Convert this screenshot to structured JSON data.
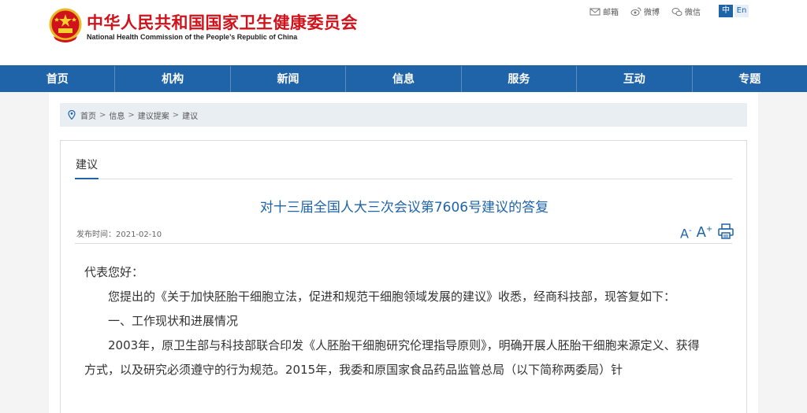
{
  "header": {
    "title_cn": "中华人民共和国国家卫生健康委员会",
    "title_en": "National Health Commission of the People’s Republic of China",
    "links": [
      {
        "label": "邮箱",
        "icon": "mail-icon"
      },
      {
        "label": "微博",
        "icon": "weibo-icon"
      },
      {
        "label": "微信",
        "icon": "wechat-icon"
      }
    ],
    "lang": {
      "zh": "中",
      "en": "En"
    }
  },
  "nav": [
    "首页",
    "机构",
    "新闻",
    "信息",
    "服务",
    "互动",
    "专题"
  ],
  "breadcrumb": [
    "首页",
    "信息",
    "建议提案",
    "建议"
  ],
  "section_label": "建议",
  "article": {
    "title": "对十三届全国人大三次会议第7606号建议的答复",
    "pubdate": "发布时间：2021-02-10",
    "paragraphs": [
      "代表您好：",
      "您提出的《关于加快胚胎干细胞立法，促进和规范干细胞领域发展的建议》收悉，经商科技部，现答复如下：",
      "一、工作现状和进展情况",
      "2003年，原卫生部与科技部联合印发《人胚胎干细胞研究伦理指导原则》，明确开展人胚胎干细胞来源定义、获得方式，以及研究必须遵守的行为规范。2015年，我委和原国家食品药品监管总局（以下简称两委局）针"
    ]
  },
  "colors": {
    "brand_red": "#d0121b",
    "brand_blue": "#1f63a8"
  }
}
